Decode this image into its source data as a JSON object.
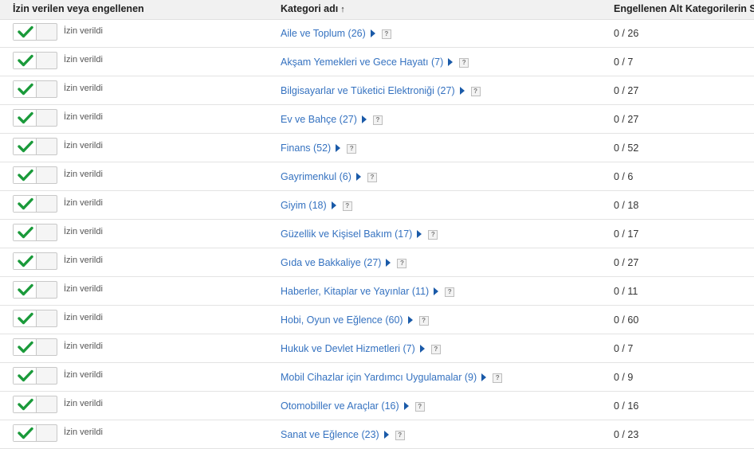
{
  "header": {
    "col_allowed": "İzin verilen veya engellenen",
    "col_category": "Kategori adı",
    "col_blocked": "Engellenen Alt Kategorilerin Sa"
  },
  "colors": {
    "link": "#3572c0",
    "check": "#1a9a3a",
    "header_bg": "#f1f1f1"
  },
  "icons": {
    "toggle": "checkmark-icon",
    "expand": "triangle-right-icon",
    "help": "help-icon",
    "sort": "arrow-up-icon"
  },
  "rows": [
    {
      "status": "İzin verildi",
      "category": "Aile ve Toplum (26)",
      "blocked": "0 / 26"
    },
    {
      "status": "İzin verildi",
      "category": "Akşam Yemekleri ve Gece Hayatı (7)",
      "blocked": "0 / 7"
    },
    {
      "status": "İzin verildi",
      "category": "Bilgisayarlar ve Tüketici Elektroniği (27)",
      "blocked": "0 / 27"
    },
    {
      "status": "İzin verildi",
      "category": "Ev ve Bahçe (27)",
      "blocked": "0 / 27"
    },
    {
      "status": "İzin verildi",
      "category": "Finans (52)",
      "blocked": "0 / 52"
    },
    {
      "status": "İzin verildi",
      "category": "Gayrimenkul (6)",
      "blocked": "0 / 6"
    },
    {
      "status": "İzin verildi",
      "category": "Giyim (18)",
      "blocked": "0 / 18"
    },
    {
      "status": "İzin verildi",
      "category": "Güzellik ve Kişisel Bakım (17)",
      "blocked": "0 / 17"
    },
    {
      "status": "İzin verildi",
      "category": "Gıda ve Bakkaliye (27)",
      "blocked": "0 / 27"
    },
    {
      "status": "İzin verildi",
      "category": "Haberler, Kitaplar ve Yayınlar (11)",
      "blocked": "0 / 11"
    },
    {
      "status": "İzin verildi",
      "category": "Hobi, Oyun ve Eğlence (60)",
      "blocked": "0 / 60"
    },
    {
      "status": "İzin verildi",
      "category": "Hukuk ve Devlet Hizmetleri (7)",
      "blocked": "0 / 7"
    },
    {
      "status": "İzin verildi",
      "category": "Mobil Cihazlar için Yardımcı Uygulamalar (9)",
      "blocked": "0 / 9"
    },
    {
      "status": "İzin verildi",
      "category": "Otomobiller ve Araçlar (16)",
      "blocked": "0 / 16"
    },
    {
      "status": "İzin verildi",
      "category": "Sanat ve Eğlence (23)",
      "blocked": "0 / 23"
    }
  ]
}
